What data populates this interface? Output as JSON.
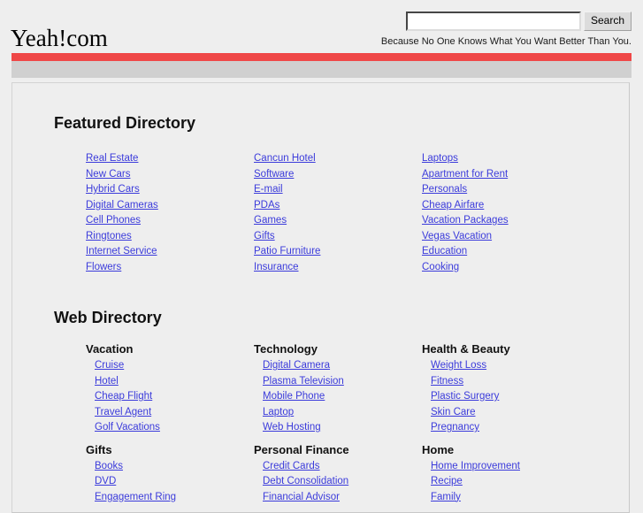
{
  "site": {
    "logo": "Yeah!com",
    "tagline": "Because No One Knows What You Want Better Than You."
  },
  "colors": {
    "page_background": "#eeeeee",
    "accent_bar": "#ef4747",
    "secondary_bar": "#d0d0d0",
    "link": "#3b3bdb",
    "text": "#000000"
  },
  "search": {
    "value": "",
    "placeholder": "",
    "button_label": "Search"
  },
  "featured": {
    "title": "Featured Directory",
    "columns": [
      {
        "links": [
          "Real Estate",
          "New Cars",
          "Hybrid Cars",
          "Digital Cameras",
          "Cell Phones",
          "Ringtones",
          "Internet Service",
          "Flowers"
        ]
      },
      {
        "links": [
          "Cancun Hotel",
          "Software",
          "E-mail",
          "PDAs",
          "Games",
          "Gifts",
          "Patio Furniture",
          "Insurance"
        ]
      },
      {
        "links": [
          "Laptops",
          "Apartment for Rent",
          "Personals",
          "Cheap Airfare",
          "Vacation Packages",
          "Vegas Vacation",
          "Education",
          "Cooking"
        ]
      }
    ]
  },
  "web_directory": {
    "title": "Web Directory",
    "columns": [
      {
        "groups": [
          {
            "title": "Vacation",
            "links": [
              "Cruise",
              "Hotel",
              "Cheap Flight",
              "Travel Agent",
              "Golf Vacations"
            ]
          },
          {
            "title": "Gifts",
            "links": [
              "Books",
              "DVD",
              "Engagement Ring"
            ]
          }
        ]
      },
      {
        "groups": [
          {
            "title": "Technology",
            "links": [
              "Digital Camera",
              "Plasma Television",
              "Mobile Phone",
              "Laptop",
              "Web Hosting"
            ]
          },
          {
            "title": "Personal Finance",
            "links": [
              "Credit Cards",
              "Debt Consolidation",
              "Financial Advisor"
            ]
          }
        ]
      },
      {
        "groups": [
          {
            "title": "Health & Beauty",
            "links": [
              "Weight Loss",
              "Fitness",
              "Plastic Surgery",
              "Skin Care",
              "Pregnancy"
            ]
          },
          {
            "title": "Home",
            "links": [
              "Home Improvement",
              "Recipe",
              "Family"
            ]
          }
        ]
      }
    ]
  }
}
